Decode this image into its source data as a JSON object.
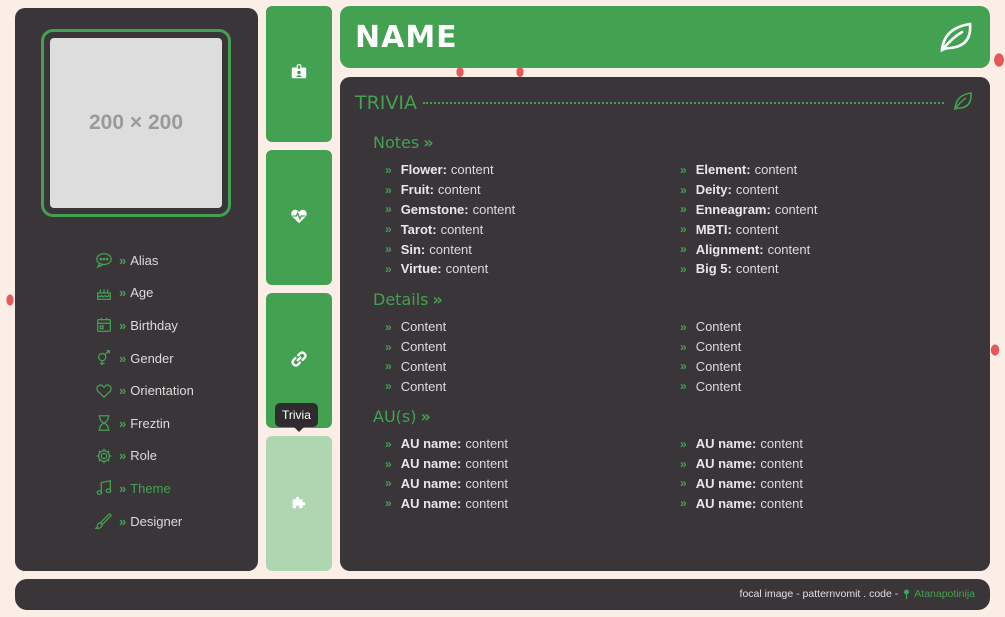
{
  "profile": {
    "portrait_placeholder": "200 × 200",
    "info": [
      {
        "icon": "speech-bubble-icon",
        "label": "Alias"
      },
      {
        "icon": "cake-icon",
        "label": "Age"
      },
      {
        "icon": "calendar-icon",
        "label": "Birthday"
      },
      {
        "icon": "gender-icon",
        "label": "Gender"
      },
      {
        "icon": "heart-icon",
        "label": "Orientation"
      },
      {
        "icon": "hourglass-icon",
        "label": "Freztin"
      },
      {
        "icon": "gear-icon",
        "label": "Role"
      },
      {
        "icon": "music-icon",
        "label": "Theme"
      },
      {
        "icon": "brush-icon",
        "label": "Designer"
      }
    ],
    "chevron": "»"
  },
  "tabs": [
    {
      "icon": "id-badge-icon"
    },
    {
      "icon": "heartbeat-icon"
    },
    {
      "icon": "link-icon"
    },
    {
      "icon": "puzzle-icon"
    }
  ],
  "tooltip": "Trivia",
  "header": {
    "title": "NAME",
    "icon": "leaf-icon"
  },
  "main": {
    "section_title": "TRIVIA",
    "notes": {
      "title": "Notes",
      "items": [
        {
          "key": "Flower:",
          "value": "content"
        },
        {
          "key": "Element:",
          "value": "content"
        },
        {
          "key": "Fruit:",
          "value": "content"
        },
        {
          "key": "Deity:",
          "value": "content"
        },
        {
          "key": "Gemstone:",
          "value": "content"
        },
        {
          "key": "Enneagram:",
          "value": "content"
        },
        {
          "key": "Tarot:",
          "value": "content"
        },
        {
          "key": "MBTI:",
          "value": "content"
        },
        {
          "key": "Sin:",
          "value": "content"
        },
        {
          "key": "Alignment:",
          "value": "content"
        },
        {
          "key": "Virtue:",
          "value": "content"
        },
        {
          "key": "Big 5:",
          "value": "content"
        }
      ]
    },
    "details": {
      "title": "Details",
      "items": [
        "Content",
        "Content",
        "Content",
        "Content",
        "Content",
        "Content",
        "Content",
        "Content"
      ]
    },
    "aus": {
      "title": "AU(s)",
      "items": [
        {
          "key": "AU name:",
          "value": "content"
        },
        {
          "key": "AU name:",
          "value": "content"
        },
        {
          "key": "AU name:",
          "value": "content"
        },
        {
          "key": "AU name:",
          "value": "content"
        },
        {
          "key": "AU name:",
          "value": "content"
        },
        {
          "key": "AU name:",
          "value": "content"
        },
        {
          "key": "AU name:",
          "value": "content"
        },
        {
          "key": "AU name:",
          "value": "content"
        }
      ]
    }
  },
  "footer": {
    "credit_text": "focal image - patternvomit . code -",
    "author": "Atanapotinija"
  },
  "colors": {
    "accent": "#43a152",
    "panel": "#3a3539",
    "tab_inactive": "#b0d5b1"
  }
}
